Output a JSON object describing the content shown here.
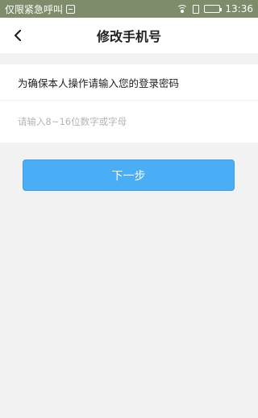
{
  "status_bar": {
    "carrier_text": "仅限紧急呼叫",
    "time": "13:36",
    "icons": [
      "sim-icon",
      "wifi-icon",
      "phone-lock-icon",
      "battery-icon"
    ]
  },
  "header": {
    "title": "修改手机号",
    "back_icon": "chevron-left-icon"
  },
  "form": {
    "prompt": "为确保本人操作请输入您的登录密码",
    "password_value": "",
    "password_placeholder": "请输入8~16位数字或字母",
    "next_label": "下一步"
  },
  "colors": {
    "status_bar_bg": "#7e8c6b",
    "page_bg": "#f2f2f2",
    "button_bg": "#49aef5"
  }
}
